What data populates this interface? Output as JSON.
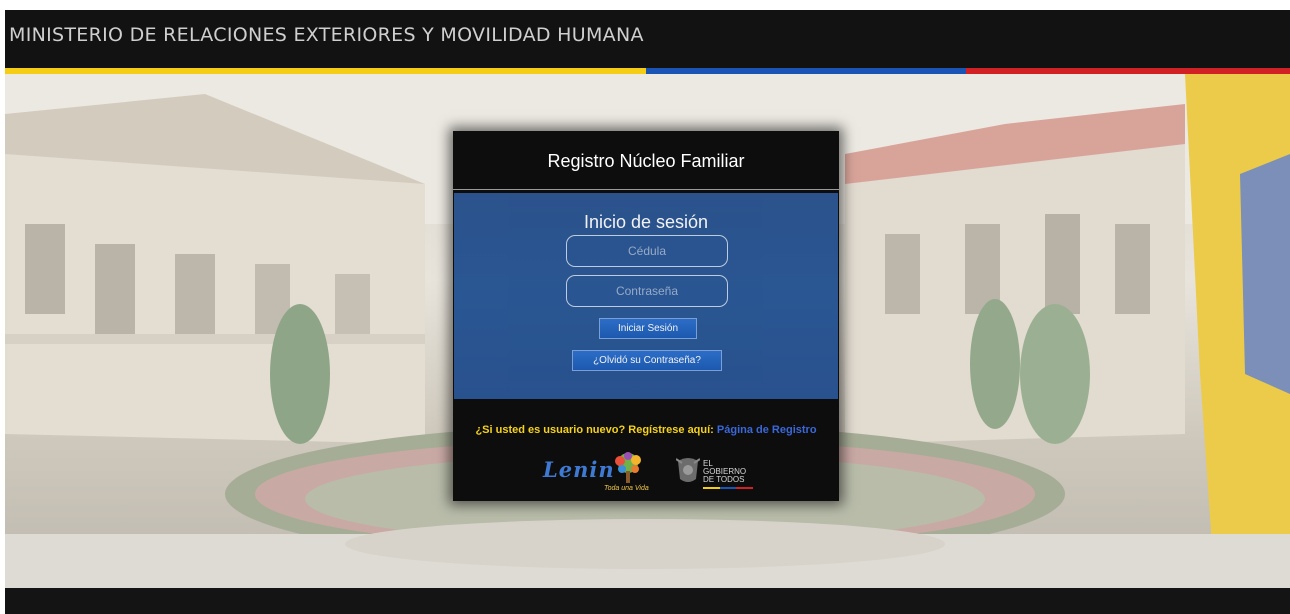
{
  "header": {
    "title": "MINISTERIO DE RELACIONES EXTERIORES Y MOVILIDAD HUMANA"
  },
  "colors": {
    "flag_yellow": "#f6cd15",
    "flag_blue": "#1a55b5",
    "flag_red": "#d22124",
    "login_panel": "#2b5a9a",
    "button": "#1e5db7",
    "register_text": "#f6d21b",
    "register_link": "#3a67d9"
  },
  "panel": {
    "title": "Registro Núcleo Familiar",
    "login": {
      "title": "Inicio de sesión",
      "cedula_placeholder": "Cédula",
      "password_placeholder": "Contraseña",
      "login_button": "Iniciar Sesión",
      "forgot_button": "¿Olvidó su Contraseña?"
    },
    "register": {
      "prompt": "¿Si usted es usuario nuevo? Regístrese aquí: ",
      "link": "Página de Registro"
    },
    "logos": {
      "lenin": "Lenin",
      "tree_caption": "Toda una Vida",
      "gobierno": [
        "EL",
        "GOBIERNO",
        "DE TODOS"
      ]
    }
  },
  "icons": [
    "lenin-logo-icon",
    "toda-una-vida-tree-icon",
    "ecuador-coat-of-arms-icon"
  ]
}
